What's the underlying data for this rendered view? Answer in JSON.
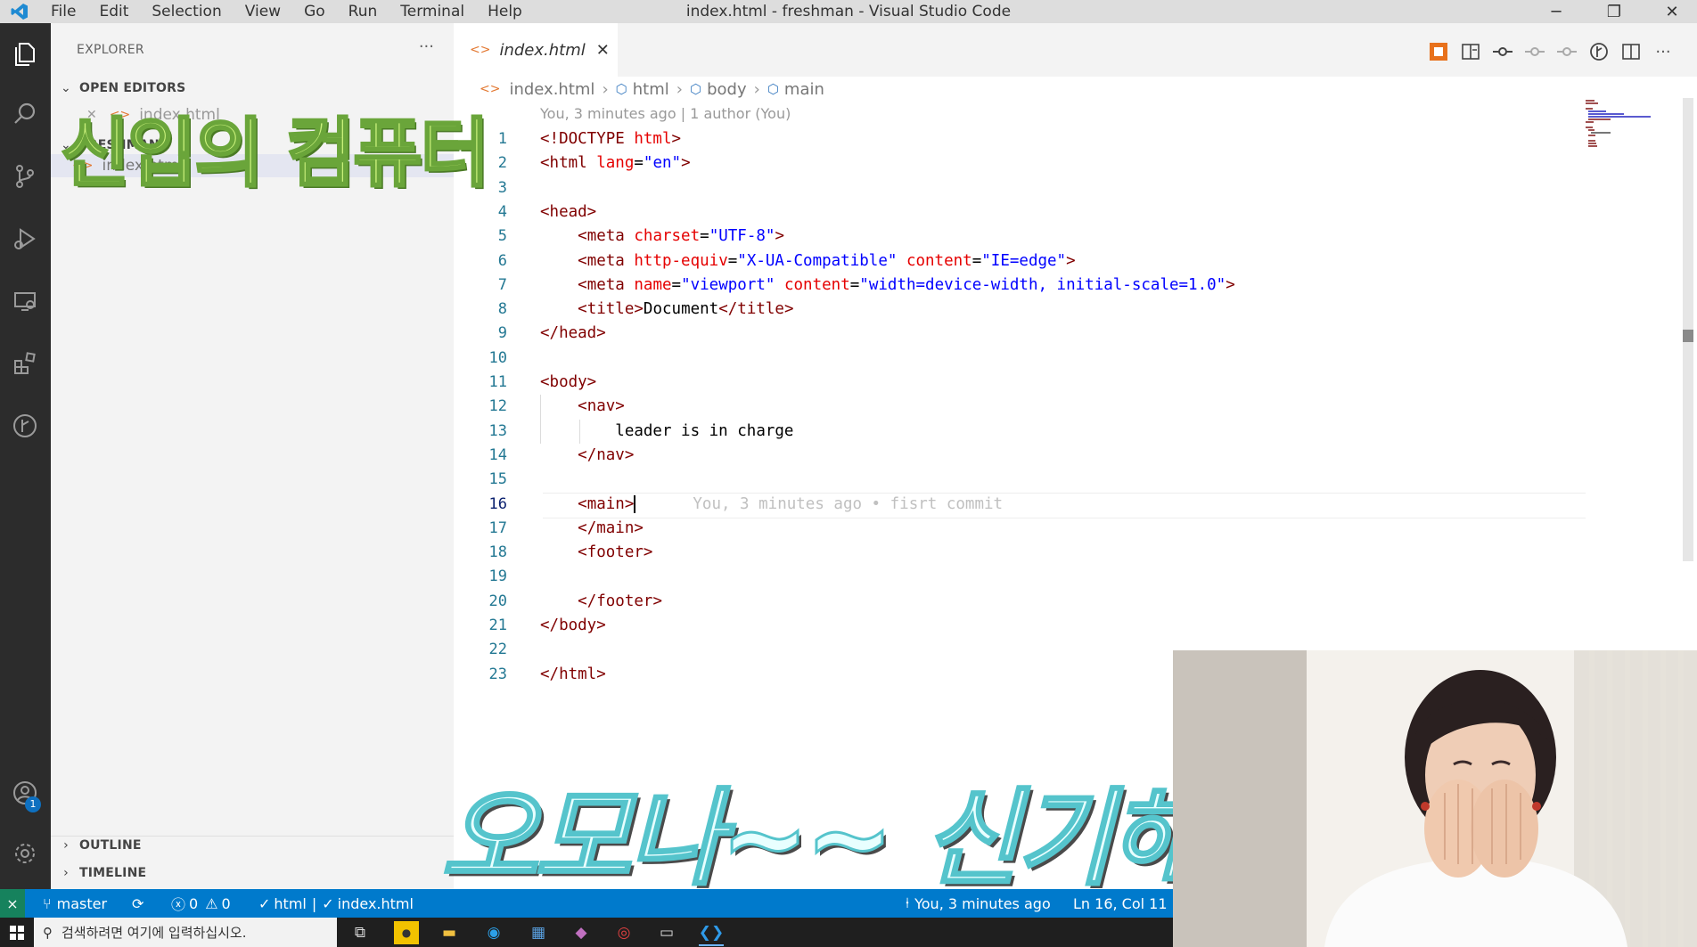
{
  "window": {
    "title": "index.html - freshman - Visual Studio Code",
    "menu": [
      "File",
      "Edit",
      "Selection",
      "View",
      "Go",
      "Run",
      "Terminal",
      "Help"
    ]
  },
  "sidebar": {
    "header": "EXPLORER",
    "more": "···",
    "open_editors_label": "OPEN EDITORS",
    "folder_label": "FRESHMAN",
    "open_editor_file": "index.html",
    "files": [
      "index.html"
    ],
    "outline_label": "OUTLINE",
    "timeline_label": "TIMELINE",
    "accounts_badge": "1"
  },
  "editor": {
    "tab_label": "index.html",
    "breadcrumb": [
      "index.html",
      "html",
      "body",
      "main"
    ],
    "codelens": "You, 3 minutes ago | 1 author (You)",
    "current_line": 16,
    "ghost_blame": "You, 3 minutes ago • fisrt commit"
  },
  "code_lines": [
    {
      "n": "1",
      "parts": [
        [
          "tg",
          "<!DOCTYPE "
        ],
        [
          "at",
          "html"
        ],
        [
          "tg",
          ">"
        ]
      ]
    },
    {
      "n": "2",
      "parts": [
        [
          "tg",
          "<html "
        ],
        [
          "at",
          "lang"
        ],
        [
          "tx",
          "="
        ],
        [
          "av",
          "\"en\""
        ],
        [
          "tg",
          ">"
        ]
      ]
    },
    {
      "n": "3",
      "parts": []
    },
    {
      "n": "4",
      "parts": [
        [
          "tg",
          "<head>"
        ]
      ]
    },
    {
      "n": "5",
      "parts": [
        [
          "tx",
          "    "
        ],
        [
          "tg",
          "<meta "
        ],
        [
          "at",
          "charset"
        ],
        [
          "tx",
          "="
        ],
        [
          "av",
          "\"UTF-8\""
        ],
        [
          "tg",
          ">"
        ]
      ]
    },
    {
      "n": "6",
      "parts": [
        [
          "tx",
          "    "
        ],
        [
          "tg",
          "<meta "
        ],
        [
          "at",
          "http-equiv"
        ],
        [
          "tx",
          "="
        ],
        [
          "av",
          "\"X-UA-Compatible\""
        ],
        [
          "tx",
          " "
        ],
        [
          "at",
          "content"
        ],
        [
          "tx",
          "="
        ],
        [
          "av",
          "\"IE=edge\""
        ],
        [
          "tg",
          ">"
        ]
      ]
    },
    {
      "n": "7",
      "parts": [
        [
          "tx",
          "    "
        ],
        [
          "tg",
          "<meta "
        ],
        [
          "at",
          "name"
        ],
        [
          "tx",
          "="
        ],
        [
          "av",
          "\"viewport\""
        ],
        [
          "tx",
          " "
        ],
        [
          "at",
          "content"
        ],
        [
          "tx",
          "="
        ],
        [
          "av",
          "\"width=device-width, initial-scale=1.0\""
        ],
        [
          "tg",
          ">"
        ]
      ]
    },
    {
      "n": "8",
      "parts": [
        [
          "tx",
          "    "
        ],
        [
          "tg",
          "<title>"
        ],
        [
          "tx",
          "Document"
        ],
        [
          "tg",
          "</title>"
        ]
      ]
    },
    {
      "n": "9",
      "parts": [
        [
          "tg",
          "</head>"
        ]
      ]
    },
    {
      "n": "10",
      "parts": []
    },
    {
      "n": "11",
      "parts": [
        [
          "tg",
          "<body>"
        ]
      ]
    },
    {
      "n": "12",
      "parts": [
        [
          "tx",
          "    "
        ],
        [
          "tg",
          "<nav>"
        ]
      ]
    },
    {
      "n": "13",
      "parts": [
        [
          "tx",
          "        leader is in charge"
        ]
      ]
    },
    {
      "n": "14",
      "parts": [
        [
          "tx",
          "    "
        ],
        [
          "tg",
          "</nav>"
        ]
      ]
    },
    {
      "n": "15",
      "parts": []
    },
    {
      "n": "16",
      "parts": [
        [
          "tx",
          "    "
        ],
        [
          "tg",
          "<main>"
        ]
      ]
    },
    {
      "n": "17",
      "parts": [
        [
          "tx",
          "    "
        ],
        [
          "tg",
          "</main>"
        ]
      ]
    },
    {
      "n": "18",
      "parts": [
        [
          "tx",
          "    "
        ],
        [
          "tg",
          "<footer>"
        ]
      ]
    },
    {
      "n": "19",
      "parts": []
    },
    {
      "n": "20",
      "parts": [
        [
          "tx",
          "    "
        ],
        [
          "tg",
          "</footer>"
        ]
      ]
    },
    {
      "n": "21",
      "parts": [
        [
          "tg",
          "</body>"
        ]
      ]
    },
    {
      "n": "22",
      "parts": []
    },
    {
      "n": "23",
      "parts": [
        [
          "tg",
          "</html>"
        ]
      ]
    }
  ],
  "statusbar": {
    "branch": "master",
    "errors": "0",
    "warnings": "0",
    "language": "html",
    "file": "index.html",
    "blame": "You, 3 minutes ago",
    "position": "Ln 16, Col 11"
  },
  "taskbar": {
    "search_placeholder": "검색하려면 여기에 입력하십시오."
  },
  "overlays": {
    "top_caption": "신입의 컴퓨터",
    "bottom_caption": "오모나~~ 신기해라~~"
  },
  "colors": {
    "statusbar": "#007acc",
    "activitybar": "#2c2c2c",
    "sidebar": "#f3f3f3",
    "tag": "#800000",
    "attribute": "#e50000",
    "value": "#0000ff"
  }
}
